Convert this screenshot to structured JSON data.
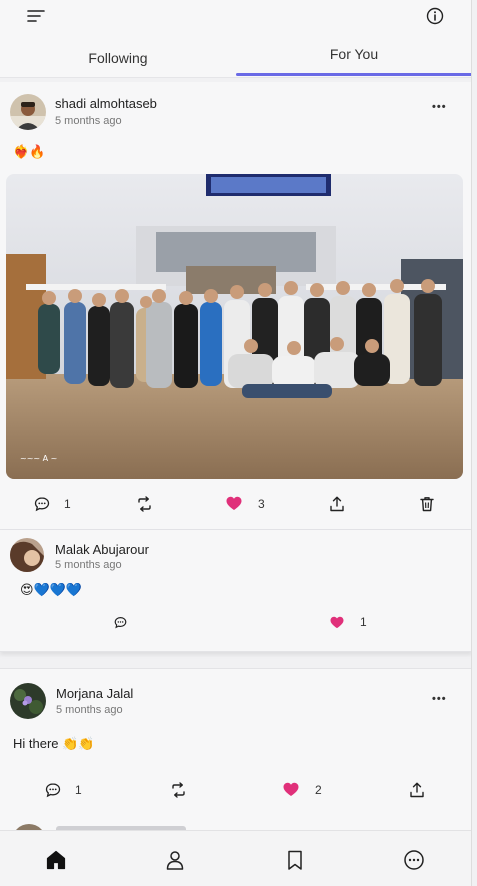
{
  "header": {
    "menu_icon": "hamburger-menu-icon",
    "info_icon": "info-icon"
  },
  "tabs": [
    {
      "label": "Following",
      "active": false
    },
    {
      "label": "For You",
      "active": true
    }
  ],
  "post1": {
    "author": "shadi almohtaseb",
    "time": "5 months ago",
    "text": "❤️‍🔥🔥",
    "more": "•••",
    "comments": "1",
    "likes": "3"
  },
  "comment": {
    "author": "Malak Abujarour",
    "time": "5 months ago",
    "text": "😍💙💙💙",
    "likes": "1"
  },
  "post2": {
    "author": "Morjana Jalal",
    "time": "5 months ago",
    "text": "Hi there 👏👏",
    "more": "•••",
    "comments": "1",
    "likes": "2"
  },
  "colors": {
    "accent": "#6a6ae6",
    "like": "#e0307a"
  }
}
